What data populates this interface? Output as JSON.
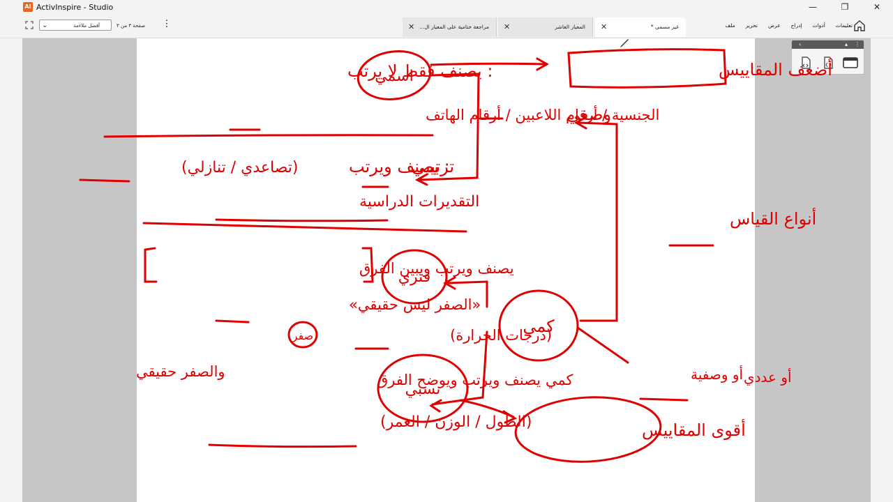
{
  "app": {
    "title": "ActivInspire - Studio",
    "logo_text": "AI",
    "logo_color": "#e8661e"
  },
  "window_controls": {
    "minimize": "—",
    "maximize": "❐",
    "close": "✕"
  },
  "toolbar": {
    "zoom_value": "أفضل ملاءمة",
    "page_count": "صفحة ٣ من ٣"
  },
  "menus": [
    "ملف",
    "تحرير",
    "عرض",
    "إدراج",
    "أدوات",
    "تعليمات"
  ],
  "tabs": [
    {
      "label": "مراجعة ختامية على المعيار ال...",
      "active": false
    },
    {
      "label": "المعيار العاشر",
      "active": false
    },
    {
      "label": "غير مسمى *",
      "active": true
    }
  ],
  "ink_color": "#e00000",
  "board": {
    "labels": {
      "nominal": "اسمي",
      "nominal_def": ": يصنف فقط لا يرتب",
      "nominal_examples": "الجنسية / أرقام اللاعبين / أرقام الهاتف",
      "ordinal": "ترتيبي",
      "ordinal_def": ": يصنف ويرتب",
      "ordinal_examples_1": "(تصاعدي / تنازلي)",
      "ordinal_examples_2": "التقديرات الدراسية",
      "weakest_scales": "أضعف المقاييس",
      "qualitative": "وصفي",
      "measurement_types": "أنواع القياس",
      "interval": "فتري",
      "interval_def": "يصنف ويرتب ويبين الفرق",
      "interval_zero": "«الصفر ليس حقيقي»",
      "interval_examples": "(درجات الحرارة)",
      "zero_word": "صفر",
      "quantitative": "كمي",
      "ratio": "نسبي",
      "ratio_def": "كمي يصنف ويرتب ويوضح الفرق",
      "ratio_zero": "والصفر حقيقي",
      "ratio_examples": "(الطول / الوزن / العمر)",
      "strongest_scales": "أقوى المقاييس",
      "qualitative_alt": "أو وصفية",
      "quantitative_alt": "أو عددي"
    }
  }
}
